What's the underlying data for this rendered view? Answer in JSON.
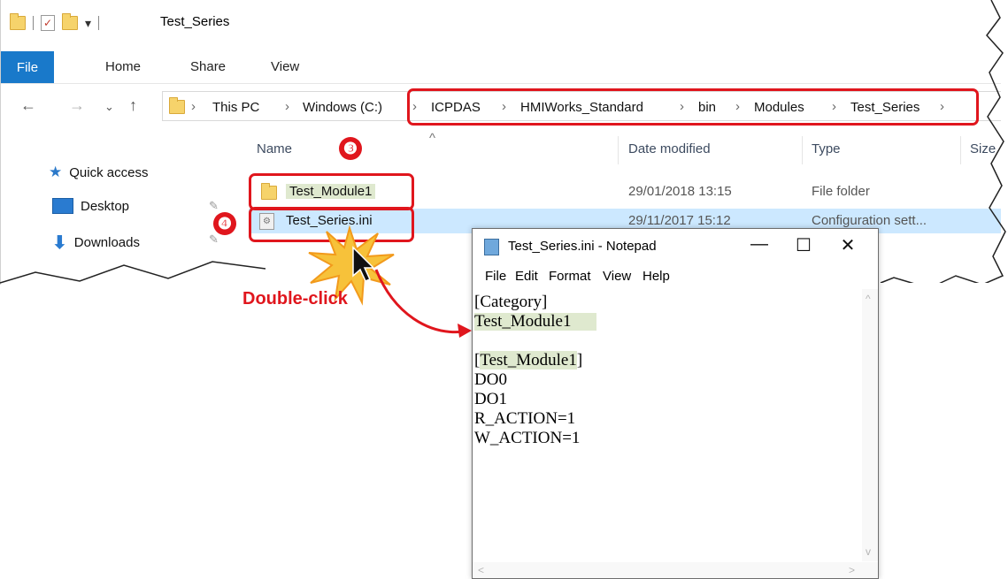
{
  "explorer": {
    "title": "Test_Series",
    "ribbon_tabs": [
      "File",
      "Home",
      "Share",
      "View"
    ],
    "breadcrumb": [
      "This PC",
      "Windows (C:)",
      "ICPDAS",
      "HMIWorks_Standard",
      "bin",
      "Modules",
      "Test_Series"
    ],
    "columns": [
      "Name",
      "Date modified",
      "Type",
      "Size"
    ],
    "sidebar": [
      "Quick access",
      "Desktop",
      "Downloads"
    ],
    "rows": [
      {
        "name": "Test_Module1",
        "date": "29/01/2018 13:15",
        "type": "File folder"
      },
      {
        "name": "Test_Series.ini",
        "date": "29/11/2017 15:12",
        "type": "Configuration sett..."
      }
    ]
  },
  "annotations": {
    "step3": "❸",
    "step4": "❹",
    "double_click": "Double-click"
  },
  "notepad": {
    "title": "Test_Series.ini - Notepad",
    "menu": [
      "File",
      "Edit",
      "Format",
      "View",
      "Help"
    ],
    "lines": [
      "[Category]",
      "Test_Module1",
      "",
      "[Test_Module1]",
      "DO0",
      "DO1",
      "R_ACTION=1",
      "W_ACTION=1"
    ]
  },
  "colors": {
    "accent": "#1979ca",
    "highlight": "#e0161d",
    "selection": "#cce8ff"
  }
}
